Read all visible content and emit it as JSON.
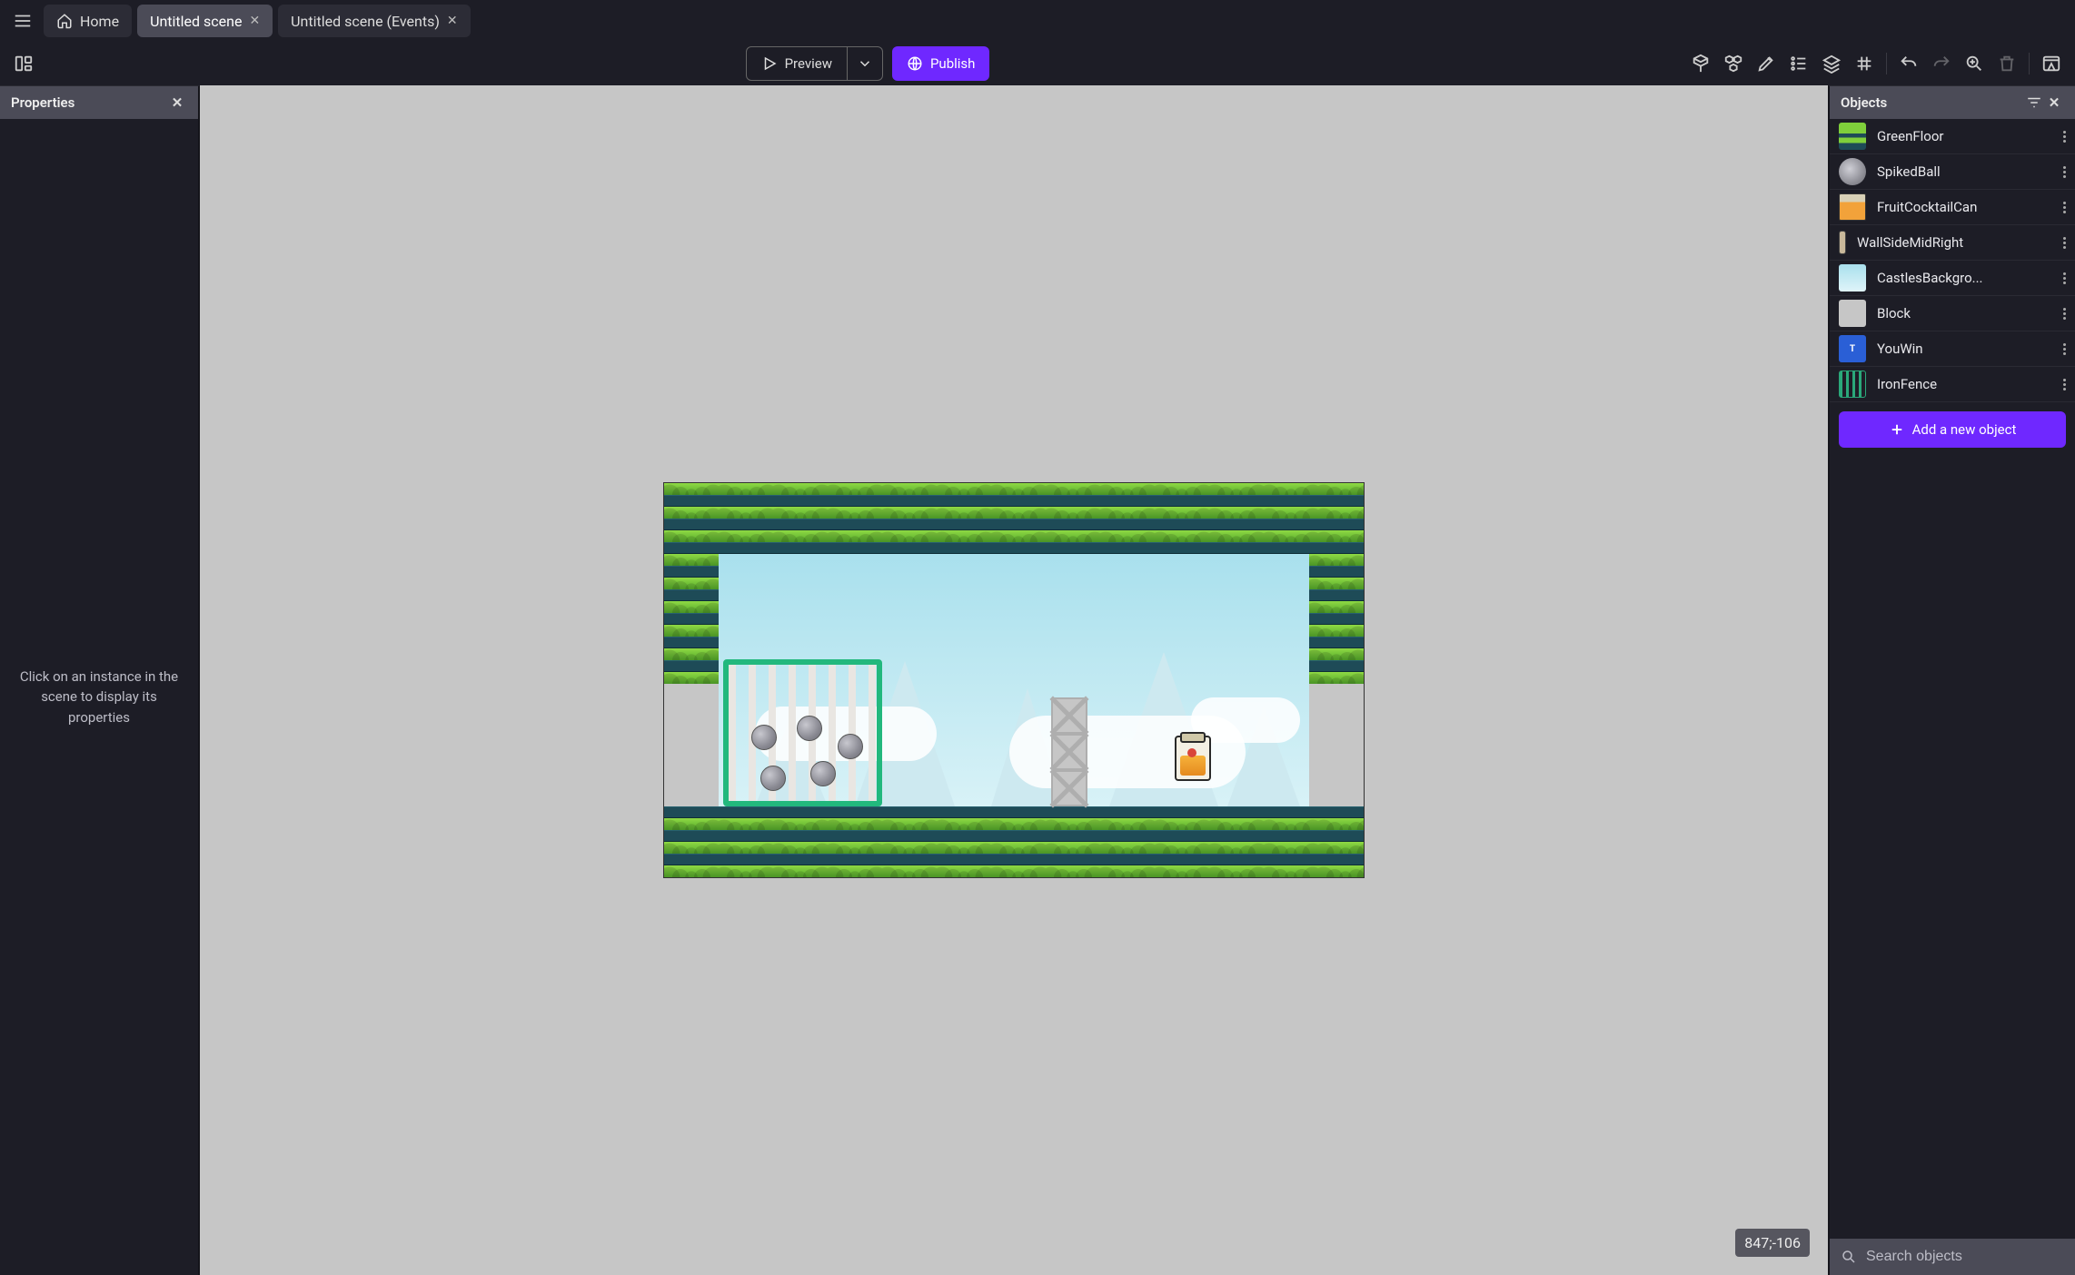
{
  "tabs": {
    "home": "Home",
    "scene": "Untitled scene",
    "events": "Untitled scene (Events)"
  },
  "toolbar": {
    "preview": "Preview",
    "publish": "Publish"
  },
  "properties": {
    "title": "Properties",
    "hint": "Click on an instance in the scene to display its properties"
  },
  "objects": {
    "title": "Objects",
    "search_placeholder": "Search objects",
    "add_label": "Add a new object",
    "list": [
      {
        "name": "GreenFloor"
      },
      {
        "name": "SpikedBall"
      },
      {
        "name": "FruitCocktailCan"
      },
      {
        "name": "WallSideMidRight"
      },
      {
        "name": "CastlesBackgro..."
      },
      {
        "name": "Block"
      },
      {
        "name": "YouWin"
      },
      {
        "name": "IronFence"
      }
    ]
  },
  "canvas": {
    "coordinates": "847;-106"
  }
}
